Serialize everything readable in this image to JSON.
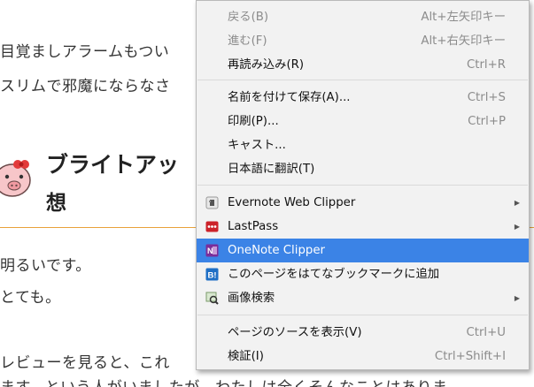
{
  "background": {
    "lines": [
      "目覚ましアラームもつい",
      "スリムで邪魔にならなさ",
      "明るいです。",
      "とても。",
      "レビューを見ると、これ",
      "ます。という人がいましたが、わたしは全くそんなことはありま"
    ],
    "heading_line1": "ブライトアッ",
    "heading_line2": "想",
    "accent": "#e8a23a"
  },
  "menu": {
    "items": [
      {
        "label": "戻る(B)",
        "shortcut": "Alt+左矢印キー"
      },
      {
        "label": "進む(F)",
        "shortcut": "Alt+右矢印キー"
      },
      {
        "label": "再読み込み(R)",
        "shortcut": "Ctrl+R"
      },
      {
        "label": "名前を付けて保存(A)...",
        "shortcut": "Ctrl+S"
      },
      {
        "label": "印刷(P)...",
        "shortcut": "Ctrl+P"
      },
      {
        "label": "キャスト..."
      },
      {
        "label": "日本語に翻訳(T)"
      },
      {
        "label": "Evernote Web Clipper",
        "icon": "evernote-icon"
      },
      {
        "label": "LastPass",
        "icon": "lastpass-icon"
      },
      {
        "label": "OneNote Clipper",
        "icon": "onenote-icon"
      },
      {
        "label": "このページをはてなブックマークに追加",
        "icon": "hatena-bookmark-icon"
      },
      {
        "label": "画像検索",
        "icon": "image-search-icon"
      },
      {
        "label": "ページのソースを表示(V)",
        "shortcut": "Ctrl+U"
      },
      {
        "label": "検証(I)",
        "shortcut": "Ctrl+Shift+I"
      }
    ],
    "highlight_color": "#3b83e6"
  }
}
